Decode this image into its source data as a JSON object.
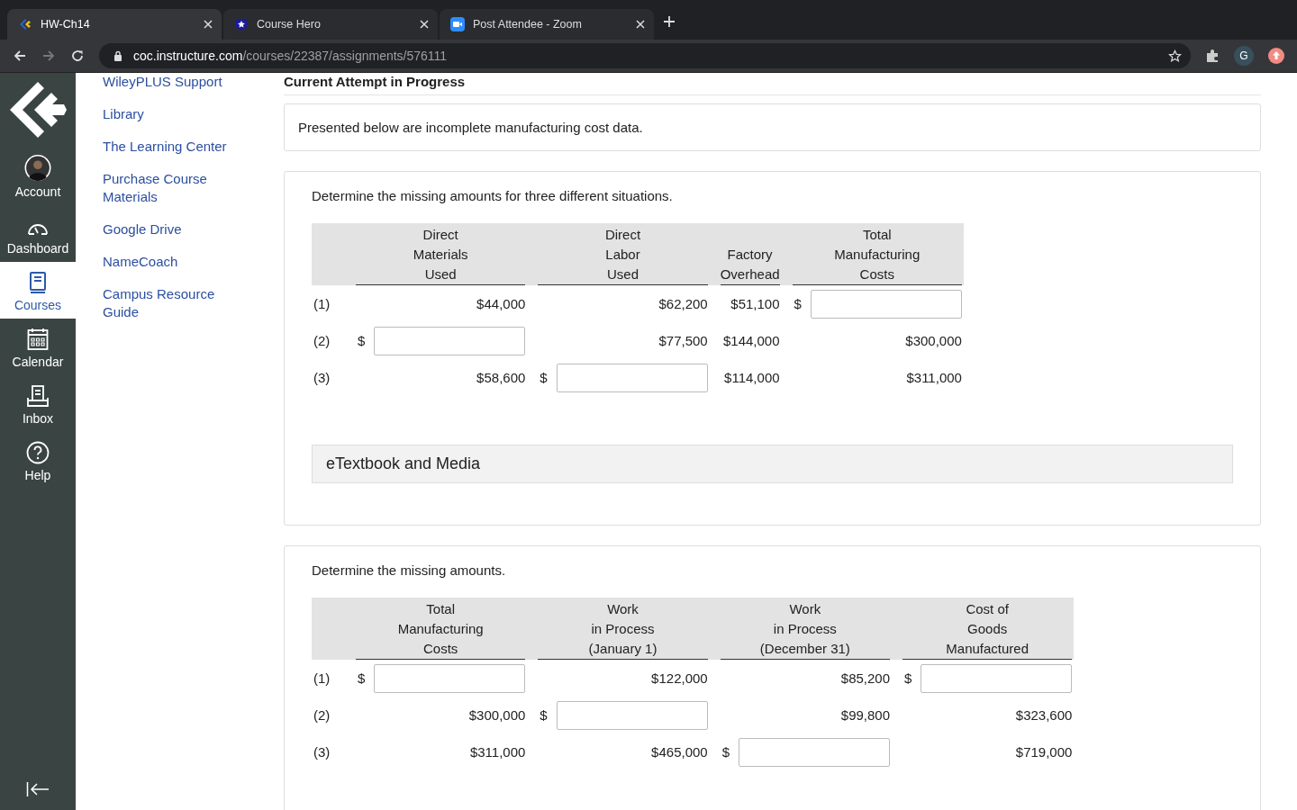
{
  "browser": {
    "tabs": [
      {
        "title": "HW-Ch14",
        "selected": true
      },
      {
        "title": "Course Hero",
        "selected": false
      },
      {
        "title": "Post Attendee - Zoom",
        "selected": false
      }
    ],
    "url": {
      "host": "coc.instructure.com",
      "path": "/courses/22387/assignments/576111"
    },
    "profile_initial": "G"
  },
  "global_nav": {
    "items": [
      {
        "kind": "account",
        "label": "Account",
        "selected": false
      },
      {
        "kind": "dashboard",
        "label": "Dashboard",
        "selected": false
      },
      {
        "kind": "courses",
        "label": "Courses",
        "selected": true
      },
      {
        "kind": "calendar",
        "label": "Calendar",
        "selected": false
      },
      {
        "kind": "inbox",
        "label": "Inbox",
        "selected": false
      },
      {
        "kind": "help",
        "label": "Help",
        "selected": false
      }
    ]
  },
  "course_nav": {
    "links": [
      "WileyPLUS Support",
      "Library",
      "The Learning Center",
      "Purchase Course Materials",
      "Google Drive",
      "NameCoach",
      "Campus Resource Guide"
    ]
  },
  "content": {
    "heading": "Current Attempt in Progress",
    "intro": "Presented below are incomplete manufacturing cost data.",
    "questions": [
      {
        "prompt": "Determine the missing amounts for three different situations.",
        "columns": [
          "Direct\nMaterials\nUsed",
          "Direct\nLabor\nUsed",
          "Factory\nOverhead",
          "Total\nManufacturing\nCosts"
        ],
        "rows": [
          {
            "label": "(1)",
            "cells": [
              {
                "kind": "value",
                "text": "$44,000"
              },
              {
                "kind": "value",
                "text": "$62,200"
              },
              {
                "kind": "value",
                "text": "$51,100"
              },
              {
                "kind": "input",
                "prefix": "$"
              }
            ]
          },
          {
            "label": "(2)",
            "cells": [
              {
                "kind": "input",
                "prefix": "$"
              },
              {
                "kind": "value",
                "text": "$77,500"
              },
              {
                "kind": "value",
                "text": "$144,000"
              },
              {
                "kind": "value",
                "text": "$300,000"
              }
            ]
          },
          {
            "label": "(3)",
            "cells": [
              {
                "kind": "value",
                "text": "$58,600"
              },
              {
                "kind": "input",
                "prefix": "$"
              },
              {
                "kind": "value",
                "text": "$114,000"
              },
              {
                "kind": "value",
                "text": "$311,000"
              }
            ]
          }
        ],
        "media_bar": "eTextbook and Media"
      },
      {
        "prompt": "Determine the missing amounts.",
        "columns": [
          "Total\nManufacturing\nCosts",
          "Work\nin Process\n(January 1)",
          "Work\nin Process\n(December 31)",
          "Cost of\nGoods\nManufactured"
        ],
        "rows": [
          {
            "label": "(1)",
            "cells": [
              {
                "kind": "input",
                "prefix": "$"
              },
              {
                "kind": "value",
                "text": "$122,000"
              },
              {
                "kind": "value",
                "text": "$85,200"
              },
              {
                "kind": "input",
                "prefix": "$"
              }
            ]
          },
          {
            "label": "(2)",
            "cells": [
              {
                "kind": "value",
                "text": "$300,000"
              },
              {
                "kind": "input",
                "prefix": "$"
              },
              {
                "kind": "value",
                "text": "$99,800"
              },
              {
                "kind": "value",
                "text": "$323,600"
              }
            ]
          },
          {
            "label": "(3)",
            "cells": [
              {
                "kind": "value",
                "text": "$311,000"
              },
              {
                "kind": "value",
                "text": "$465,000"
              },
              {
                "kind": "input",
                "prefix": "$"
              },
              {
                "kind": "value",
                "text": "$719,000"
              }
            ]
          }
        ]
      }
    ]
  }
}
